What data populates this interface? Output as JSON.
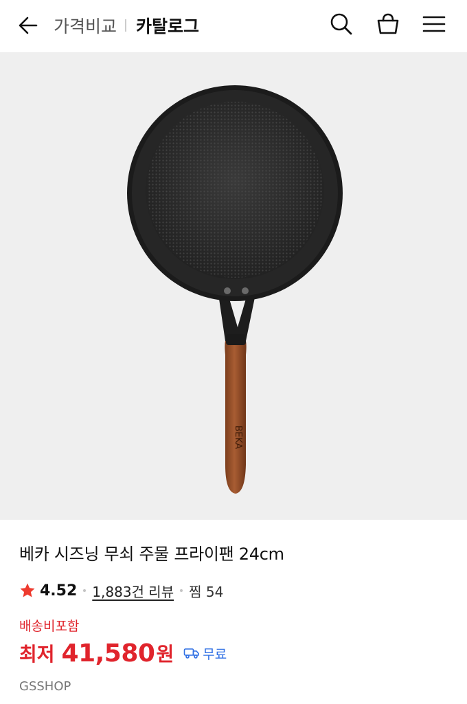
{
  "header": {
    "back_icon": "arrow-left-icon",
    "breadcrumb_parent": "가격비교",
    "breadcrumb_current": "카탈로그",
    "icons": [
      "search-icon",
      "shopping-bag-icon",
      "menu-icon"
    ]
  },
  "product": {
    "image_brand_mark": "BEKA",
    "title": "베카 시즈닝 무쇠 주물 프라이팬 24cm",
    "rating": "4.52",
    "review_count": "1,883건 리뷰",
    "wish": "찜 54",
    "shipping_note": "배송비포함",
    "price_label": "최저",
    "price_value": "41,580",
    "price_unit": "원",
    "free_shipping_label": "무료",
    "seller": "GSSHOP"
  },
  "colors": {
    "accent_red": "#e0242c",
    "link_blue": "#2f6fe4",
    "star": "#ee3b2f",
    "image_bg": "#efefef"
  }
}
